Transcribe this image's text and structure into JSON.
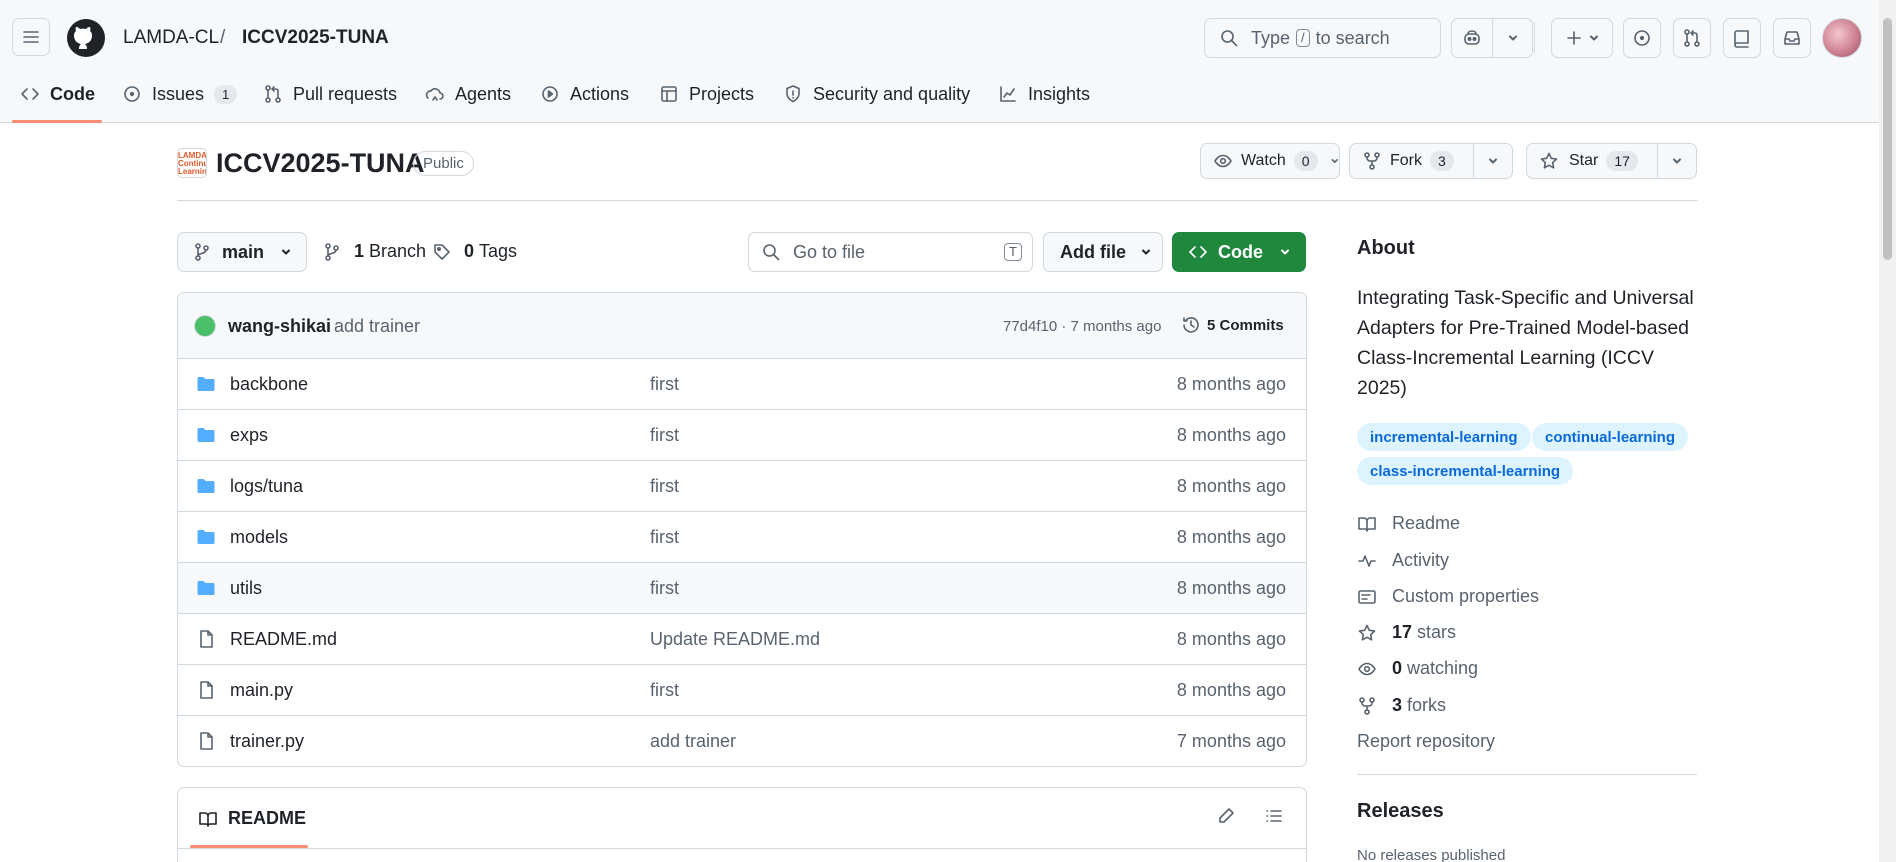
{
  "header": {
    "owner": "LAMDA-CL",
    "separator": "/",
    "repo": "ICCV2025-TUNA",
    "search_prefix": "Type",
    "search_key": "/",
    "search_suffix": "to search"
  },
  "tabs": [
    {
      "label": "Code",
      "icon": "code-icon"
    },
    {
      "label": "Issues",
      "icon": "issue-icon",
      "count": "1"
    },
    {
      "label": "Pull requests",
      "icon": "pull-request-icon"
    },
    {
      "label": "Agents",
      "icon": "agents-icon"
    },
    {
      "label": "Actions",
      "icon": "play-icon"
    },
    {
      "label": "Projects",
      "icon": "table-icon"
    },
    {
      "label": "Security and quality",
      "icon": "shield-icon"
    },
    {
      "label": "Insights",
      "icon": "graph-icon"
    }
  ],
  "repo": {
    "name": "ICCV2025-TUNA",
    "visibility": "Public",
    "avatar_text": "LAMDA Continual Learning",
    "watch_label": "Watch",
    "watch_count": "0",
    "fork_label": "Fork",
    "fork_count": "3",
    "star_label": "Star",
    "star_count": "17"
  },
  "toolbar": {
    "branch": "main",
    "branch_count": "1",
    "branch_label": "Branch",
    "tag_count": "0",
    "tag_label": "Tags",
    "goto_placeholder": "Go to file",
    "goto_key": "T",
    "add_file": "Add file",
    "code": "Code"
  },
  "commit": {
    "user": "wang-shikai",
    "message": "add trainer",
    "hash_time": "77d4f10 · 7 months ago",
    "commits_label": "5 Commits"
  },
  "files": [
    {
      "type": "dir",
      "name": "backbone",
      "message": "first",
      "date": "8 months ago"
    },
    {
      "type": "dir",
      "name": "exps",
      "message": "first",
      "date": "8 months ago"
    },
    {
      "type": "dir",
      "name": "logs/tuna",
      "message": "first",
      "date": "8 months ago"
    },
    {
      "type": "dir",
      "name": "models",
      "message": "first",
      "date": "8 months ago"
    },
    {
      "type": "dir",
      "name": "utils",
      "message": "first",
      "date": "8 months ago"
    },
    {
      "type": "file",
      "name": "README.md",
      "message": "Update README.md",
      "date": "8 months ago"
    },
    {
      "type": "file",
      "name": "main.py",
      "message": "first",
      "date": "8 months ago"
    },
    {
      "type": "file",
      "name": "trainer.py",
      "message": "add trainer",
      "date": "7 months ago"
    }
  ],
  "readme": {
    "tab_label": "README"
  },
  "about": {
    "heading": "About",
    "description": "Integrating Task-Specific and Universal Adapters for Pre-Trained Model-based Class-Incremental Learning (ICCV 2025)",
    "topics": [
      "incremental-learning",
      "continual-learning",
      "class-incremental-learning"
    ],
    "links": {
      "readme": "Readme",
      "activity": "Activity",
      "custom_properties": "Custom properties",
      "stars_count": "17",
      "stars_label": "stars",
      "watching_count": "0",
      "watching_label": "watching",
      "forks_count": "3",
      "forks_label": "forks",
      "report": "Report repository"
    }
  },
  "releases": {
    "heading": "Releases",
    "empty": "No releases published"
  },
  "colors": {
    "accent_underline": "#fd8c73",
    "code_button": "#1f883d",
    "topic_bg": "#ddf4ff",
    "topic_text": "#0969da",
    "folder": "#54aeff"
  }
}
